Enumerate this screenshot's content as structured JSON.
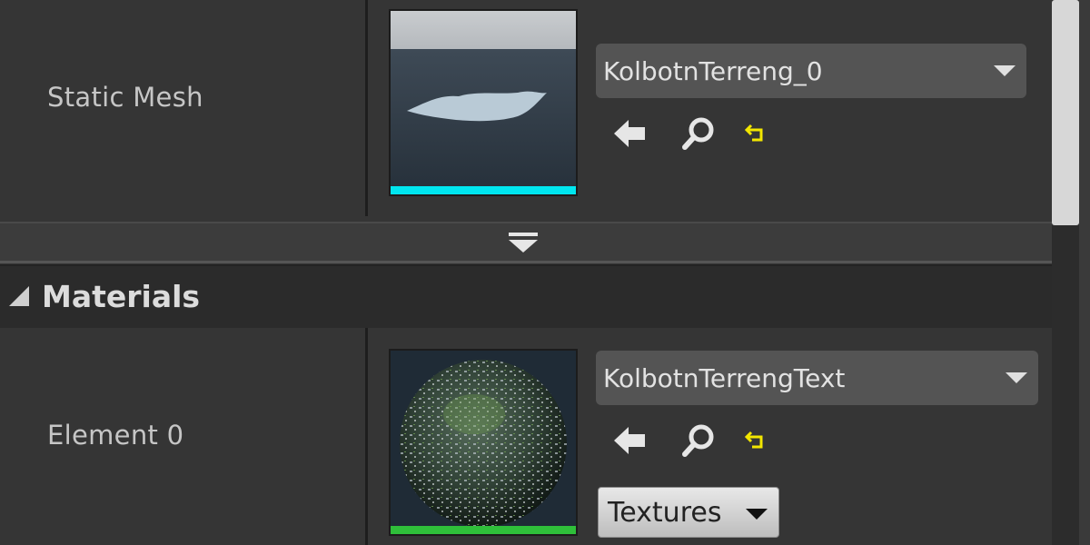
{
  "static_mesh": {
    "label": "Static Mesh",
    "asset_name": "KolbotnTerreng_0",
    "thumb_bar_color": "#00e6f0",
    "icons": [
      "browse-use-arrow-icon",
      "find-in-browser-icon",
      "reset-to-default-icon"
    ]
  },
  "materials": {
    "category_title": "Materials",
    "element_label": "Element 0",
    "asset_name": "KolbotnTerrengText",
    "thumb_bar_color": "#2fbf3a",
    "textures_button_label": "Textures",
    "icons": [
      "browse-use-arrow-icon",
      "find-in-browser-icon",
      "reset-to-default-icon"
    ]
  },
  "colors": {
    "panel_bg": "#353535",
    "combo_bg": "#545454",
    "reset_icon": "#f2e600"
  }
}
